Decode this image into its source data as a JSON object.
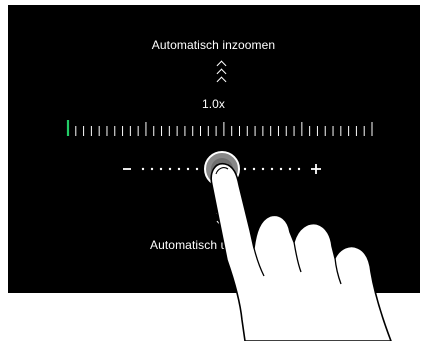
{
  "zoom_in_label": "Automatisch inzoomen",
  "zoom_out_label": "Automatisch uitzoomen",
  "zoom_value": "1.0x",
  "zoom_level": 1.0,
  "slider": {
    "minus_label": "–",
    "plus_label": "+"
  },
  "icons": {
    "zoom_in_chevrons": "triple-chevron-up-icon",
    "zoom_out_chevrons": "triple-chevron-down-icon",
    "hand": "pointing-finger-icon"
  },
  "colors": {
    "screen_background": "#000000",
    "text": "#ffffff",
    "ruler_start_tick": "#22cc66",
    "knob": "#888888"
  }
}
